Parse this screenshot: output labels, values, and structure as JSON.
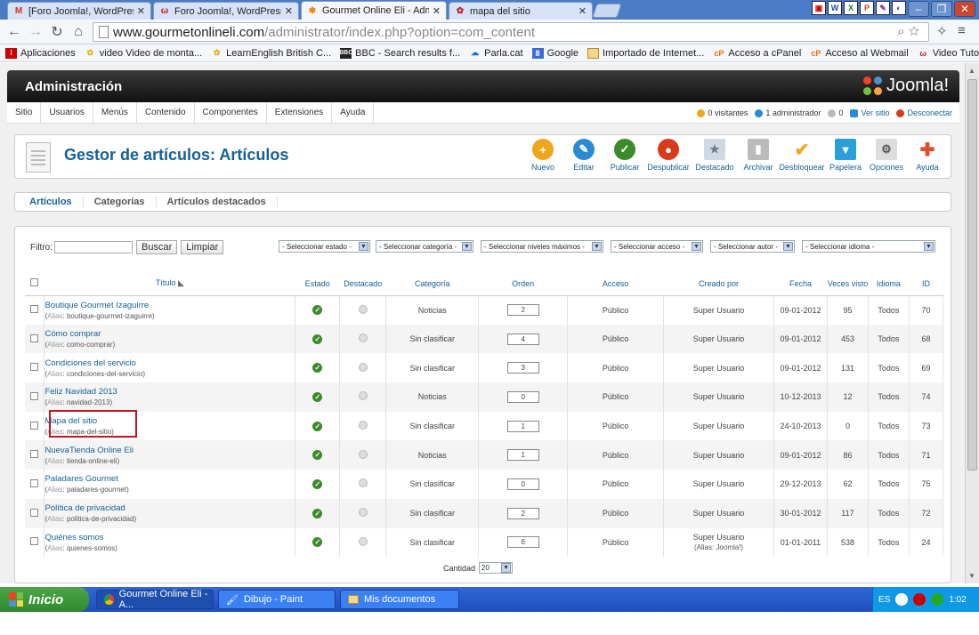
{
  "browser": {
    "tabs": [
      {
        "label": "[Foro Joomla!, WordPress y",
        "icon": "gmail-icon",
        "active": false
      },
      {
        "label": "Foro Joomla!, WordPress y F",
        "icon": "forum-icon",
        "active": false
      },
      {
        "label": "Gourmet Online Eli - Administ",
        "icon": "joomla-icon",
        "active": true
      },
      {
        "label": "mapa del sitio",
        "icon": "page-icon",
        "active": false
      }
    ],
    "url_host": "www.gourmetonlineli.com",
    "url_path": "/administrator/index.php?option=com_content",
    "bookmarks": [
      {
        "label": "Aplicaciones",
        "icon": "apps-icon"
      },
      {
        "label": "video Video de monta...",
        "icon": "flower-icon"
      },
      {
        "label": "LearnEnglish British C...",
        "icon": "flower-icon"
      },
      {
        "label": "BBC - Search results f...",
        "icon": "bbc-icon"
      },
      {
        "label": "Parla.cat",
        "icon": "parla-icon"
      },
      {
        "label": "Google",
        "icon": "google-icon"
      },
      {
        "label": "Importado de Internet...",
        "icon": "folder-icon"
      },
      {
        "label": "Acceso a cPanel",
        "icon": "cpanel-icon"
      },
      {
        "label": "Acceso al Webmail",
        "icon": "cpanel-icon"
      },
      {
        "label": "Video Tutoriales Pack ...",
        "icon": "forum-icon"
      }
    ]
  },
  "admin": {
    "header_title": "Administración",
    "logo_text": "Joomla!",
    "menu": [
      "Sitio",
      "Usuarios",
      "Menús",
      "Contenido",
      "Componentes",
      "Extensiones",
      "Ayuda"
    ],
    "status": {
      "visitors": "0 visitantes",
      "admins": "1 administrador",
      "messages": "0",
      "view_site": "Ver sitio",
      "logout": "Desconectar"
    },
    "page_title": "Gestor de artículos: Artículos",
    "toolbar": [
      {
        "label": "Nuevo",
        "color": "#f0a61c",
        "glyph": "+"
      },
      {
        "label": "Editar",
        "color": "#2a8ad4",
        "glyph": "✎"
      },
      {
        "label": "Publicar",
        "color": "#3b8b2a",
        "glyph": "✓"
      },
      {
        "label": "Despublicar",
        "color": "#d83a1c",
        "glyph": "●"
      },
      {
        "label": "Destacado",
        "color": "#cfd8e3",
        "glyph": "★"
      },
      {
        "label": "Archivar",
        "color": "#bbbbbb",
        "glyph": "▮"
      },
      {
        "label": "Desbloquear",
        "color": "#f0a61c",
        "glyph": "✔"
      },
      {
        "label": "Papelera",
        "color": "#2a9fd8",
        "glyph": "▼"
      },
      {
        "label": "Opciones",
        "color": "#cccccc",
        "glyph": "⚙"
      },
      {
        "label": "Ayuda",
        "color": "#e24a2a",
        "glyph": "✚"
      }
    ],
    "subtabs": [
      "Artículos",
      "Categorías",
      "Artículos destacados"
    ],
    "filter": {
      "label": "Filtro:",
      "search_btn": "Buscar",
      "clear_btn": "Limpiar",
      "selects": [
        "- Seleccionar estado -",
        "- Seleccionar categoría -",
        "- Seleccionar niveles máximos -",
        "- Seleccionar acceso -",
        "- Seleccionar autor -",
        "- Seleccionar idioma -"
      ]
    },
    "columns": [
      "Título",
      "Estado",
      "Destacado",
      "Categoría",
      "Orden",
      "Acceso",
      "Creado por",
      "Fecha",
      "Veces visto",
      "Idioma",
      "ID"
    ],
    "alias_label": "Alias",
    "rows": [
      {
        "title": "Boutique Gourmet Izaguirre",
        "alias": "boutique-gourmet-izaguirre",
        "category": "Noticias",
        "order": "2",
        "access": "Público",
        "author": "Super Usuario",
        "author_alias": "",
        "date": "09-01-2012",
        "hits": "95",
        "lang": "Todos",
        "id": "70"
      },
      {
        "title": "Cómo comprar",
        "alias": "como-comprar",
        "category": "Sin clasificar",
        "order": "4",
        "access": "Público",
        "author": "Super Usuario",
        "author_alias": "",
        "date": "09-01-2012",
        "hits": "453",
        "lang": "Todos",
        "id": "68"
      },
      {
        "title": "Condiciones del servicio",
        "alias": "condiciones-del-servicio",
        "category": "Sin clasificar",
        "order": "3",
        "access": "Público",
        "author": "Super Usuario",
        "author_alias": "",
        "date": "09-01-2012",
        "hits": "131",
        "lang": "Todos",
        "id": "69"
      },
      {
        "title": "Feliz Navidad 2013",
        "alias": "navidad-2013",
        "category": "Noticias",
        "order": "0",
        "access": "Público",
        "author": "Super Usuario",
        "author_alias": "",
        "date": "10-12-2013",
        "hits": "12",
        "lang": "Todos",
        "id": "74"
      },
      {
        "title": "Mapa del sitio",
        "alias": "mapa-del-sitio",
        "category": "Sin clasificar",
        "order": "1",
        "access": "Público",
        "author": "Super Usuario",
        "author_alias": "",
        "date": "24-10-2013",
        "hits": "0",
        "lang": "Todos",
        "id": "73"
      },
      {
        "title": "NuevaTienda Online Eli",
        "alias": "tienda-online-eli",
        "category": "Noticias",
        "order": "1",
        "access": "Público",
        "author": "Super Usuario",
        "author_alias": "",
        "date": "09-01-2012",
        "hits": "86",
        "lang": "Todos",
        "id": "71"
      },
      {
        "title": "Paladares Gourmet",
        "alias": "paladares-gourmet",
        "category": "Sin clasificar",
        "order": "0",
        "access": "Público",
        "author": "Super Usuario",
        "author_alias": "",
        "date": "29-12-2013",
        "hits": "62",
        "lang": "Todos",
        "id": "75"
      },
      {
        "title": "Política de privacidad",
        "alias": "politica-de-privacidad",
        "category": "Sin clasificar",
        "order": "2",
        "access": "Público",
        "author": "Super Usuario",
        "author_alias": "",
        "date": "30-01-2012",
        "hits": "117",
        "lang": "Todos",
        "id": "72"
      },
      {
        "title": "Quiénes somos",
        "alias": "quienes-somos",
        "category": "Sin clasificar",
        "order": "6",
        "access": "Público",
        "author": "Super Usuario",
        "author_alias": "(Alias: Joomla!)",
        "date": "01-01-2011",
        "hits": "538",
        "lang": "Todos",
        "id": "24"
      }
    ],
    "pager": {
      "label": "Cantidad",
      "value": "20"
    }
  },
  "taskbar": {
    "start": "Inicio",
    "tasks": [
      {
        "label": "Gourmet Online Eli - A...",
        "icon": "chrome-icon",
        "active": true
      },
      {
        "label": "Dibujo - Paint",
        "icon": "paint-icon",
        "active": false
      },
      {
        "label": "Mis documentos",
        "icon": "folder-icon",
        "active": false
      }
    ],
    "lang": "ES",
    "clock": "1:02"
  }
}
